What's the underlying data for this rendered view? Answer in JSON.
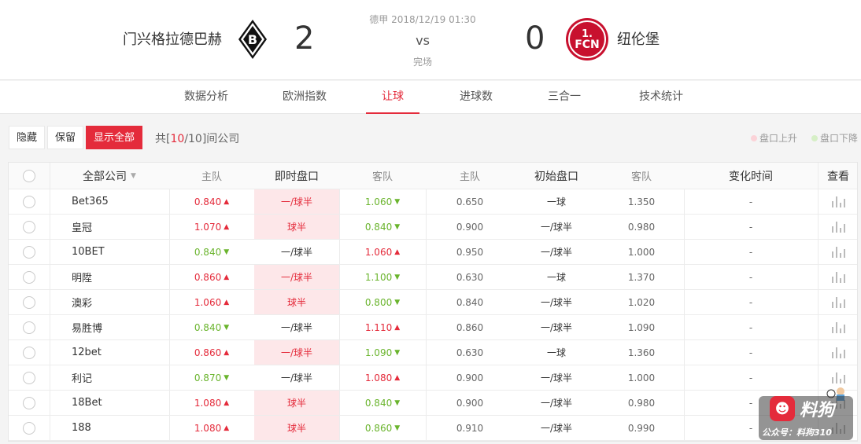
{
  "match": {
    "home_team": "门兴格拉德巴赫",
    "away_team": "纽伦堡",
    "home_score": "2",
    "away_score": "0",
    "league_time": "德甲 2018/12/19 01:30",
    "vs": "vs",
    "status": "完场"
  },
  "logos": {
    "home_logo_text": "B",
    "away_logo_text_top": "1.",
    "away_logo_text_bottom": "FCN"
  },
  "tabs": [
    {
      "label": "数据分析"
    },
    {
      "label": "欧洲指数"
    },
    {
      "label": "让球"
    },
    {
      "label": "进球数"
    },
    {
      "label": "三合一"
    },
    {
      "label": "技术统计"
    }
  ],
  "active_tab": "让球",
  "toolbar": {
    "hide_label": "隐藏",
    "keep_label": "保留",
    "show_all_label": "显示全部",
    "count_prefix": "共[",
    "count_shown": "10",
    "count_sep": "/",
    "count_total": "10",
    "count_suffix": "]间公司",
    "legend_up": "盘口上升",
    "legend_down": "盘口下降"
  },
  "colors": {
    "accent": "#e42b3b",
    "up": "#e42b3b",
    "down": "#6ab42d",
    "live_highlight": "#fde7e9"
  },
  "table": {
    "headers": {
      "company": "全部公司",
      "live_home": "主队",
      "live_line": "即时盘口",
      "live_away": "客队",
      "init_home": "主队",
      "init_line": "初始盘口",
      "init_away": "客队",
      "change_time": "变化时间",
      "view": "查看"
    },
    "rows": [
      {
        "company": "Bet365",
        "live_home": "0.840",
        "home_dir": "up",
        "live_line": "一/球半",
        "line_changed": true,
        "live_away": "1.060",
        "away_dir": "down",
        "init_home": "0.650",
        "init_line": "一球",
        "init_away": "1.350",
        "change_time": "-"
      },
      {
        "company": "皇冠",
        "live_home": "1.070",
        "home_dir": "up",
        "live_line": "球半",
        "line_changed": true,
        "live_away": "0.840",
        "away_dir": "down",
        "init_home": "0.900",
        "init_line": "一/球半",
        "init_away": "0.980",
        "change_time": "-"
      },
      {
        "company": "10BET",
        "live_home": "0.840",
        "home_dir": "down",
        "live_line": "一/球半",
        "line_changed": false,
        "live_away": "1.060",
        "away_dir": "up",
        "init_home": "0.950",
        "init_line": "一/球半",
        "init_away": "1.000",
        "change_time": "-"
      },
      {
        "company": "明陞",
        "live_home": "0.860",
        "home_dir": "up",
        "live_line": "一/球半",
        "line_changed": true,
        "live_away": "1.100",
        "away_dir": "down",
        "init_home": "0.630",
        "init_line": "一球",
        "init_away": "1.370",
        "change_time": "-"
      },
      {
        "company": "澳彩",
        "live_home": "1.060",
        "home_dir": "up",
        "live_line": "球半",
        "line_changed": true,
        "live_away": "0.800",
        "away_dir": "down",
        "init_home": "0.840",
        "init_line": "一/球半",
        "init_away": "1.020",
        "change_time": "-"
      },
      {
        "company": "易胜博",
        "live_home": "0.840",
        "home_dir": "down",
        "live_line": "一/球半",
        "line_changed": false,
        "live_away": "1.110",
        "away_dir": "up",
        "init_home": "0.860",
        "init_line": "一/球半",
        "init_away": "1.090",
        "change_time": "-"
      },
      {
        "company": "12bet",
        "live_home": "0.860",
        "home_dir": "up",
        "live_line": "一/球半",
        "line_changed": true,
        "live_away": "1.090",
        "away_dir": "down",
        "init_home": "0.630",
        "init_line": "一球",
        "init_away": "1.360",
        "change_time": "-"
      },
      {
        "company": "利记",
        "live_home": "0.870",
        "home_dir": "down",
        "live_line": "一/球半",
        "line_changed": false,
        "live_away": "1.080",
        "away_dir": "up",
        "init_home": "0.900",
        "init_line": "一/球半",
        "init_away": "1.000",
        "change_time": "-"
      },
      {
        "company": "18Bet",
        "live_home": "1.080",
        "home_dir": "up",
        "live_line": "球半",
        "line_changed": true,
        "live_away": "0.840",
        "away_dir": "down",
        "init_home": "0.900",
        "init_line": "一/球半",
        "init_away": "0.980",
        "change_time": "-"
      },
      {
        "company": "188",
        "live_home": "1.080",
        "home_dir": "up",
        "live_line": "球半",
        "line_changed": true,
        "live_away": "0.860",
        "away_dir": "down",
        "init_home": "0.910",
        "init_line": "一/球半",
        "init_away": "0.990",
        "change_time": "-"
      }
    ]
  },
  "watermark": {
    "title": "料狗",
    "subtitle": "公众号：料狗310"
  }
}
